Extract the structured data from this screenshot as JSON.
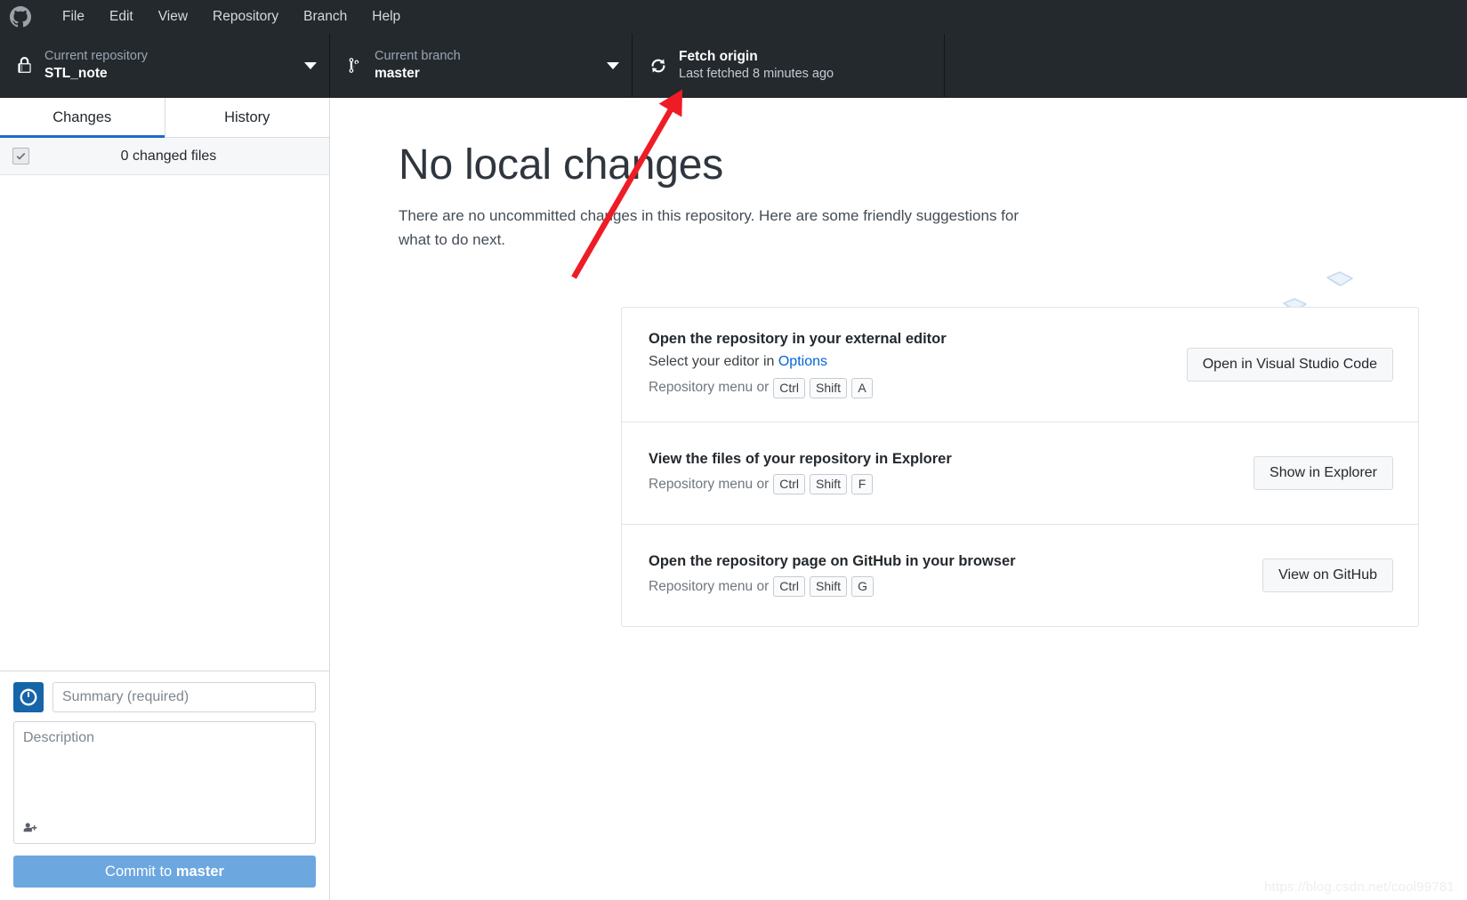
{
  "menubar": {
    "logo_icon": "github-mark-icon",
    "items": [
      {
        "label": "File"
      },
      {
        "label": "Edit"
      },
      {
        "label": "View"
      },
      {
        "label": "Repository"
      },
      {
        "label": "Branch"
      },
      {
        "label": "Help"
      }
    ]
  },
  "toolbar": {
    "repository": {
      "icon": "lock-icon",
      "label": "Current repository",
      "value": "STL_note",
      "caret_icon": "chevron-down-icon"
    },
    "branch": {
      "icon": "git-branch-icon",
      "label": "Current branch",
      "value": "master",
      "caret_icon": "chevron-down-icon"
    },
    "fetch": {
      "icon": "sync-icon",
      "title": "Fetch origin",
      "subtitle": "Last fetched 8 minutes ago"
    }
  },
  "sidebar": {
    "tabs": [
      {
        "label": "Changes",
        "active": true
      },
      {
        "label": "History",
        "active": false
      }
    ],
    "changed_files_label": "0 changed files",
    "checkbox_icon": "checkmark-icon",
    "commit": {
      "avatar_icon": "default-avatar-icon",
      "summary_placeholder": "Summary (required)",
      "summary_value": "",
      "description_placeholder": "Description",
      "description_value": "",
      "coauthor_icon": "add-person-icon",
      "button_prefix": "Commit to ",
      "button_branch": "master"
    }
  },
  "main": {
    "title": "No local changes",
    "subtitle": "There are no uncommitted changes in this repository. Here are some friendly suggestions for what to do next.",
    "illustration_icon": "empty-boxes-illustration",
    "suggestions": [
      {
        "title": "Open the repository in your external editor",
        "subtitle_prefix": "Select your editor in ",
        "subtitle_link": "Options",
        "shortcut_prefix": "Repository menu or",
        "keys": [
          "Ctrl",
          "Shift",
          "A"
        ],
        "button": "Open in Visual Studio Code"
      },
      {
        "title": "View the files of your repository in Explorer",
        "subtitle_prefix": "",
        "subtitle_link": "",
        "shortcut_prefix": "Repository menu or",
        "keys": [
          "Ctrl",
          "Shift",
          "F"
        ],
        "button": "Show in Explorer"
      },
      {
        "title": "Open the repository page on GitHub in your browser",
        "subtitle_prefix": "",
        "subtitle_link": "",
        "shortcut_prefix": "Repository menu or",
        "keys": [
          "Ctrl",
          "Shift",
          "G"
        ],
        "button": "View on GitHub"
      }
    ]
  },
  "annotation": {
    "arrow_icon": "red-arrow-annotation",
    "arrow_color": "#ee1c25"
  },
  "watermark": {
    "text": "https://blog.csdn.net/cool99781"
  },
  "colors": {
    "toolbar_bg": "#24292e",
    "accent_blue": "#1b6ac9",
    "link_blue": "#0366d6",
    "commit_button": "#6ca7e0",
    "annotation_red": "#ee1c25"
  }
}
